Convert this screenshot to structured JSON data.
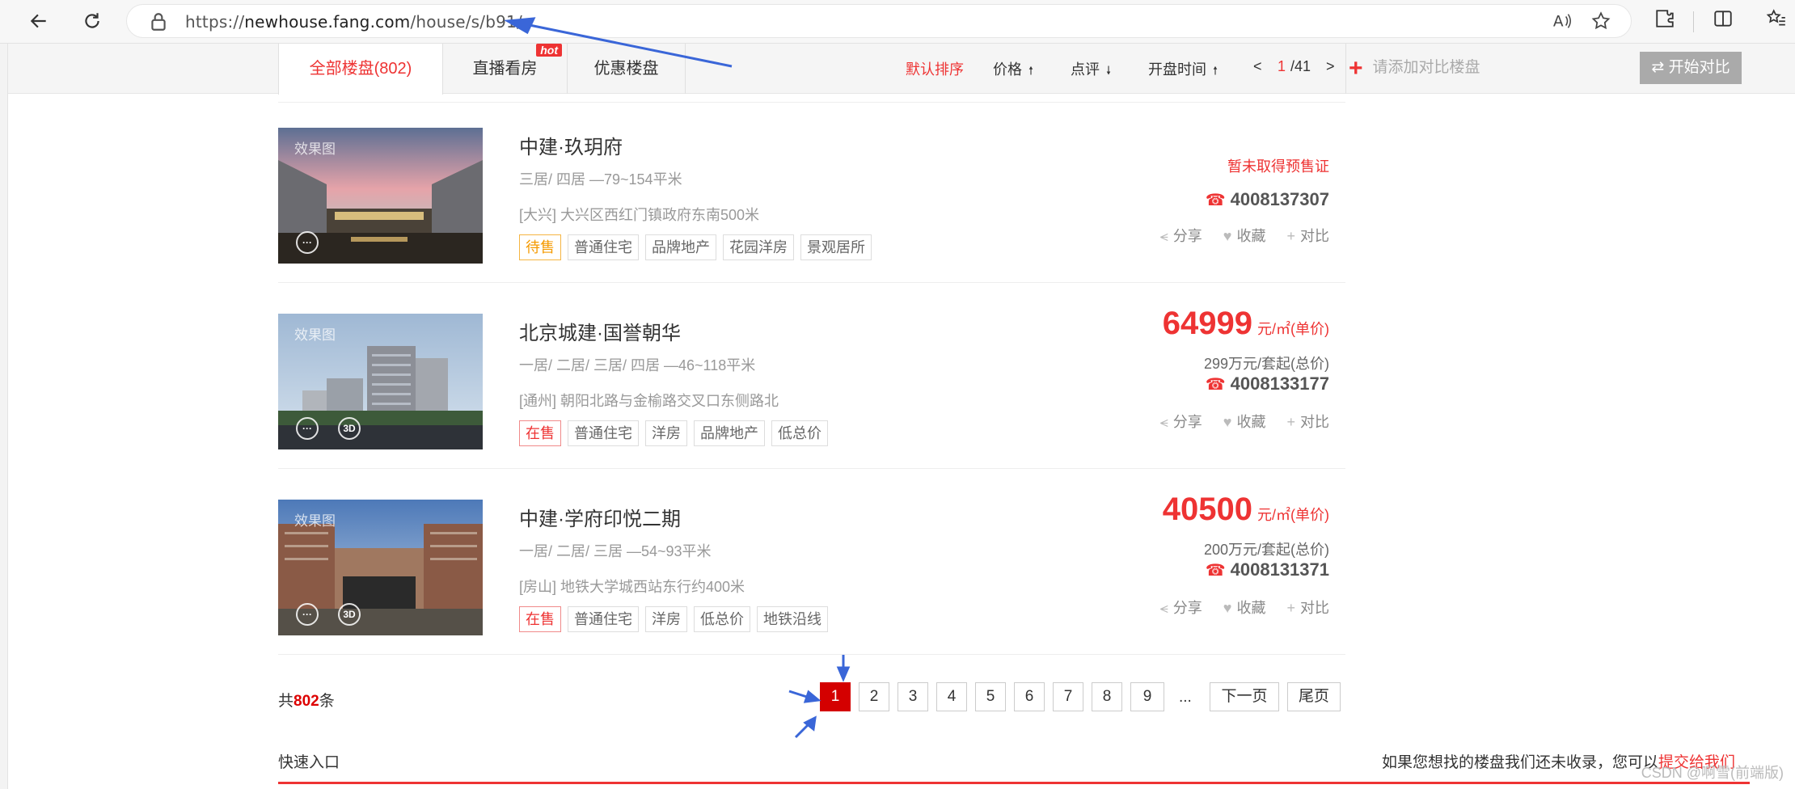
{
  "browser": {
    "url_prefix": "https://",
    "url_domain": "newhouse.fang.com",
    "url_path": "/house/s/b91/"
  },
  "tabs": [
    {
      "label": "全部楼盘(802)",
      "active": true
    },
    {
      "label": "直播看房",
      "badge": "hot"
    },
    {
      "label": "优惠楼盘"
    }
  ],
  "sort": {
    "default": "默认排序",
    "price": "价格",
    "rating": "点评",
    "open_time": "开盘时间"
  },
  "mini_pager": {
    "prev": "<",
    "current": "1",
    "total": "/41",
    "next": ">"
  },
  "compare": {
    "placeholder": "请添加对比楼盘",
    "button": "开始对比"
  },
  "listings": [
    {
      "name": "中建·玖玥府",
      "rooms": "三居/ 四居 —79~154平米",
      "address": "[大兴] 大兴区西红门镇政府东南500米",
      "tags": [
        {
          "t": "待售",
          "style": "orange"
        },
        {
          "t": "普通住宅"
        },
        {
          "t": "品牌地产"
        },
        {
          "t": "花园洋房"
        },
        {
          "t": "景观居所"
        }
      ],
      "status": "暂未取得预售证",
      "phone": "4008137307",
      "watermark": "效果图",
      "has3d": false
    },
    {
      "name": "北京城建·国誉朝华",
      "rooms": "一居/ 二居/ 三居/ 四居 —46~118平米",
      "address": "[通州] 朝阳北路与金榆路交叉口东侧路北",
      "tags": [
        {
          "t": "在售",
          "style": "red"
        },
        {
          "t": "普通住宅"
        },
        {
          "t": "洋房"
        },
        {
          "t": "品牌地产"
        },
        {
          "t": "低总价"
        }
      ],
      "price": "64999",
      "price_unit": "元/㎡(单价)",
      "total": "299万元/套起(总价)",
      "phone": "4008133177",
      "watermark": "效果图",
      "has3d": true
    },
    {
      "name": "中建·学府印悦二期",
      "rooms": "一居/ 二居/ 三居 —54~93平米",
      "address": "[房山] 地铁大学城西站东行约400米",
      "tags": [
        {
          "t": "在售",
          "style": "red"
        },
        {
          "t": "普通住宅"
        },
        {
          "t": "洋房"
        },
        {
          "t": "低总价"
        },
        {
          "t": "地铁沿线"
        }
      ],
      "price": "40500",
      "price_unit": "元/㎡(单价)",
      "total": "200万元/套起(总价)",
      "phone": "4008131371",
      "watermark": "效果图",
      "has3d": true
    }
  ],
  "actions": {
    "share": "分享",
    "fav": "收藏",
    "compare": "对比"
  },
  "pagination": {
    "total_prefix": "共",
    "total": "802",
    "total_suffix": "条",
    "pages": [
      "1",
      "2",
      "3",
      "4",
      "5",
      "6",
      "7",
      "8",
      "9"
    ],
    "current": "1",
    "ellipsis": "...",
    "next": "下一页",
    "last": "尾页"
  },
  "footer": {
    "quick_entry": "快速入口",
    "submit_note": "如果您想找的楼盘我们还未收录，您可以",
    "submit_link": "提交给我们",
    "watermark": "CSDN @啊雪(前端版)"
  },
  "colors": {
    "accent": "#e33333",
    "annotation": "#3a66d8"
  }
}
